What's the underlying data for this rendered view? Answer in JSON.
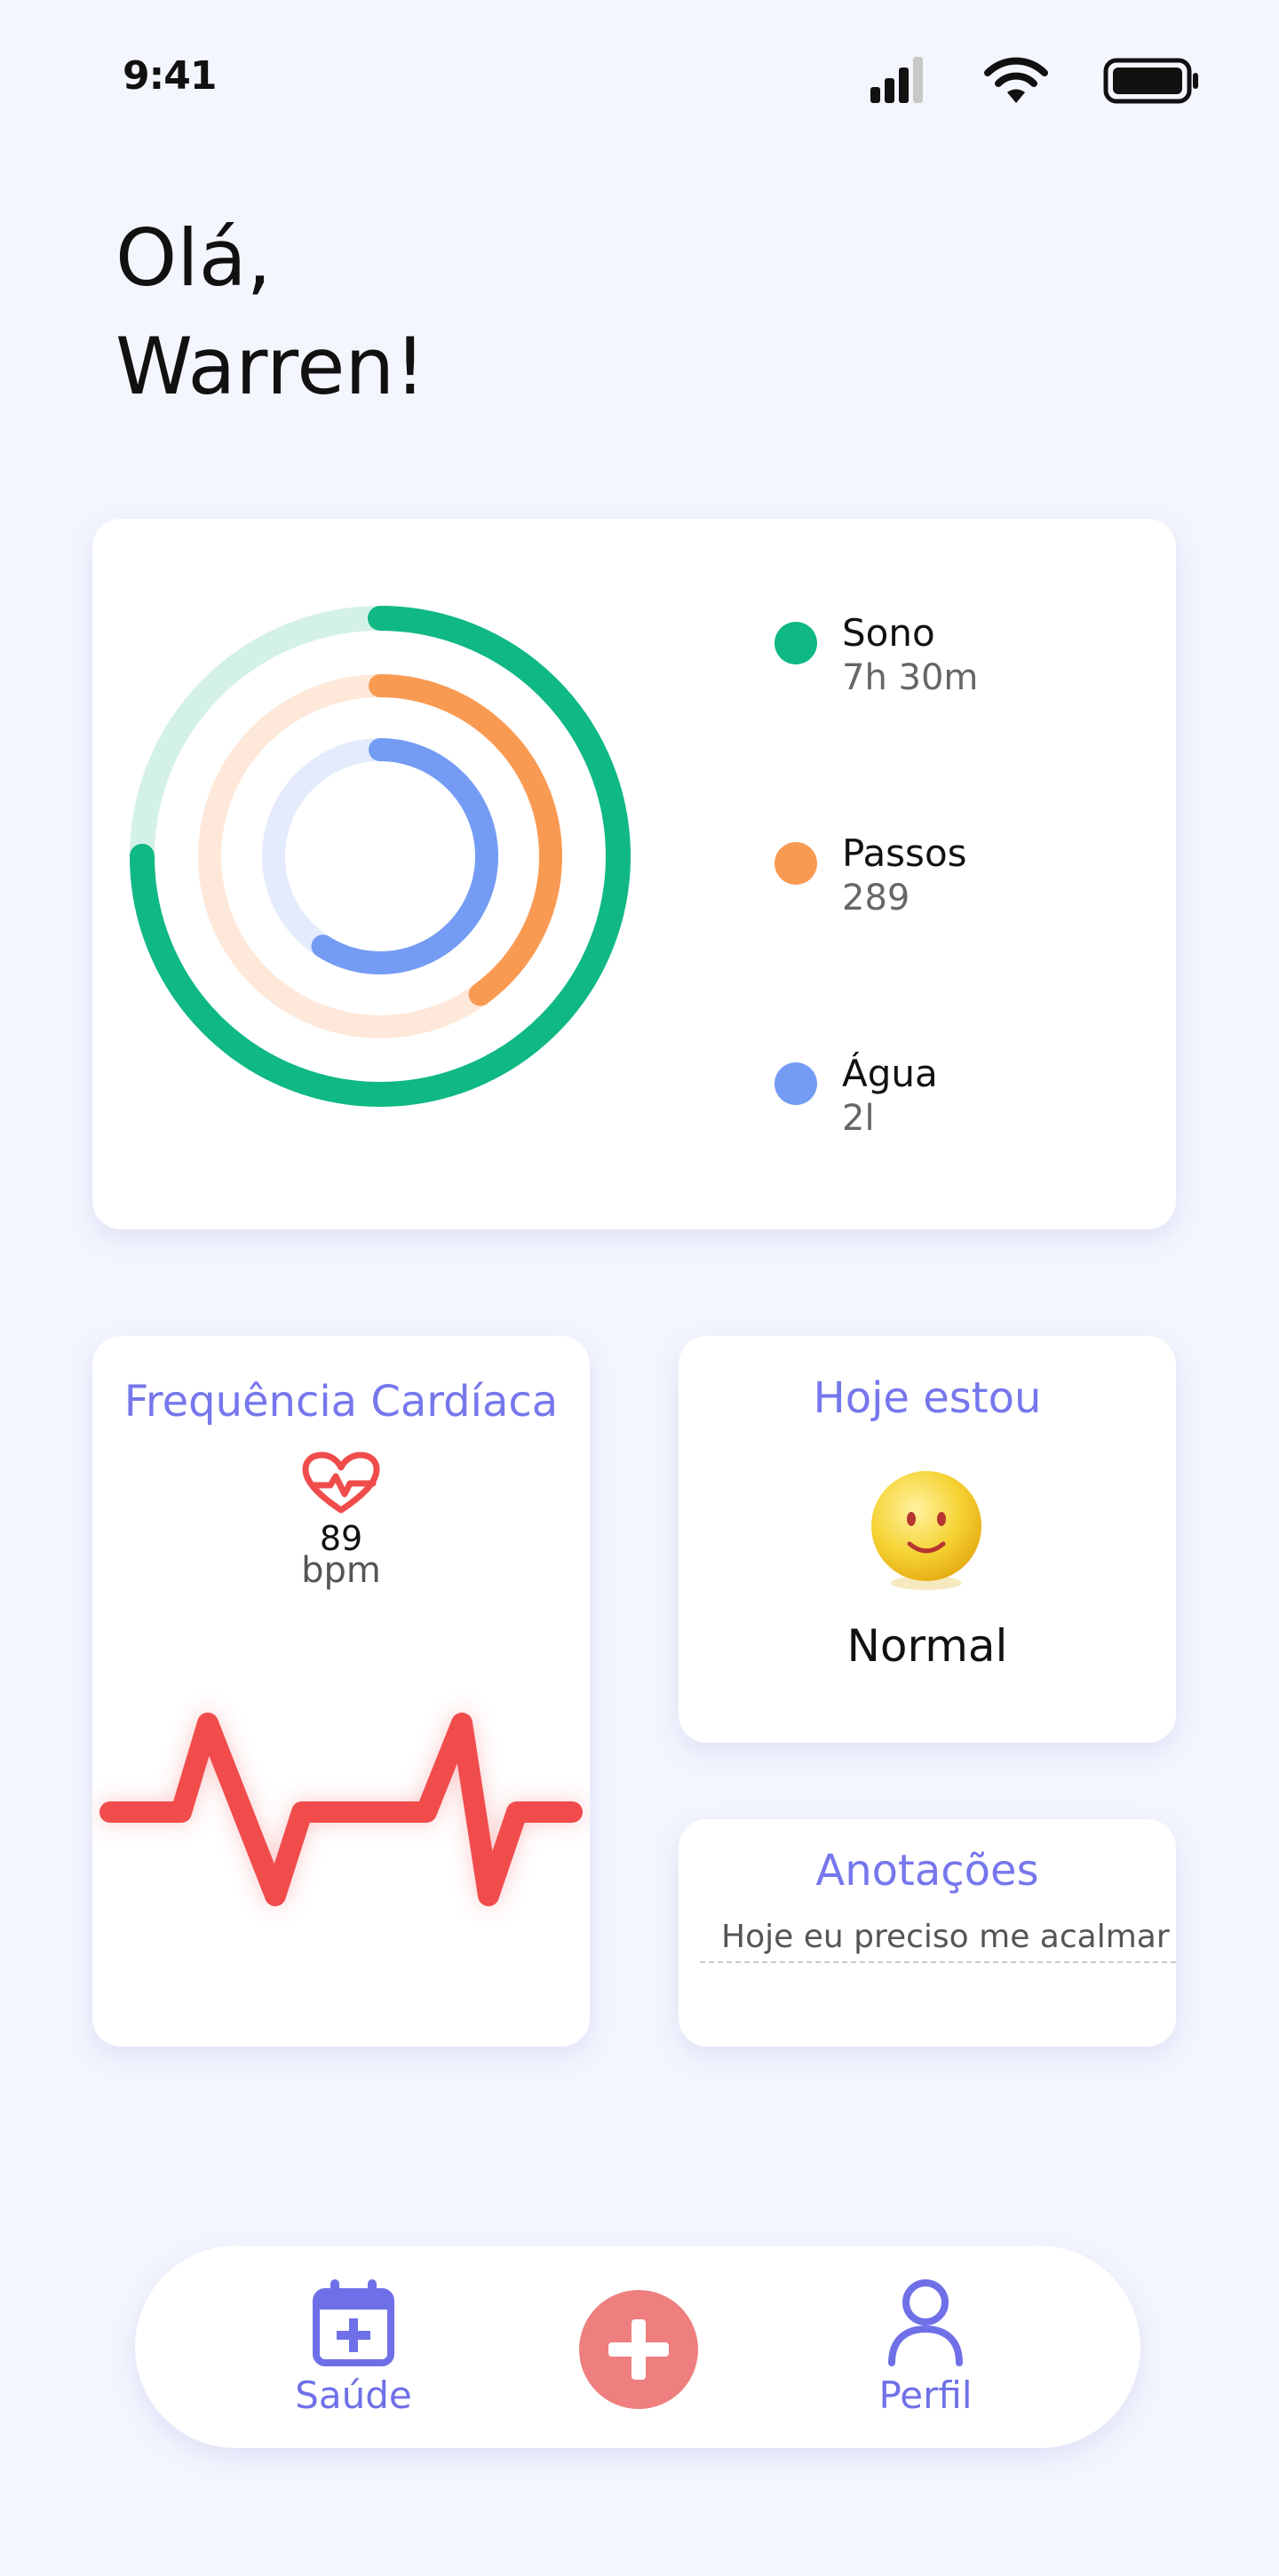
{
  "status_bar": {
    "time": "9:41"
  },
  "greeting": {
    "line1": "Olá,",
    "line2": "Warren!"
  },
  "activity": {
    "items": [
      {
        "label": "Sono",
        "value": "7h 30m",
        "color": "#0fb884",
        "track_color": "#d4f1e8",
        "progress": 0.75
      },
      {
        "label": "Passos",
        "value": "289",
        "color": "#f99a53",
        "track_color": "#fde8da",
        "progress": 0.4
      },
      {
        "label": "Água",
        "value": "2l",
        "color": "#749cf4",
        "track_color": "#e3ebfc",
        "progress": 0.59
      }
    ]
  },
  "heart_rate": {
    "title": "Frequência Cardíaca",
    "value": "89",
    "unit": "bpm",
    "icon": "heart-pulse-icon",
    "color": "#f04c4c"
  },
  "mood": {
    "title": "Hoje estou",
    "value": "Normal",
    "icon": "smiley-face-icon"
  },
  "notes": {
    "title": "Anotações",
    "text": "Hoje eu preciso me acalmar"
  },
  "nav": {
    "health_label": "Saúde",
    "profile_label": "Perfil",
    "accent": "#6f70e8",
    "add_color": "#ef7f7f"
  }
}
